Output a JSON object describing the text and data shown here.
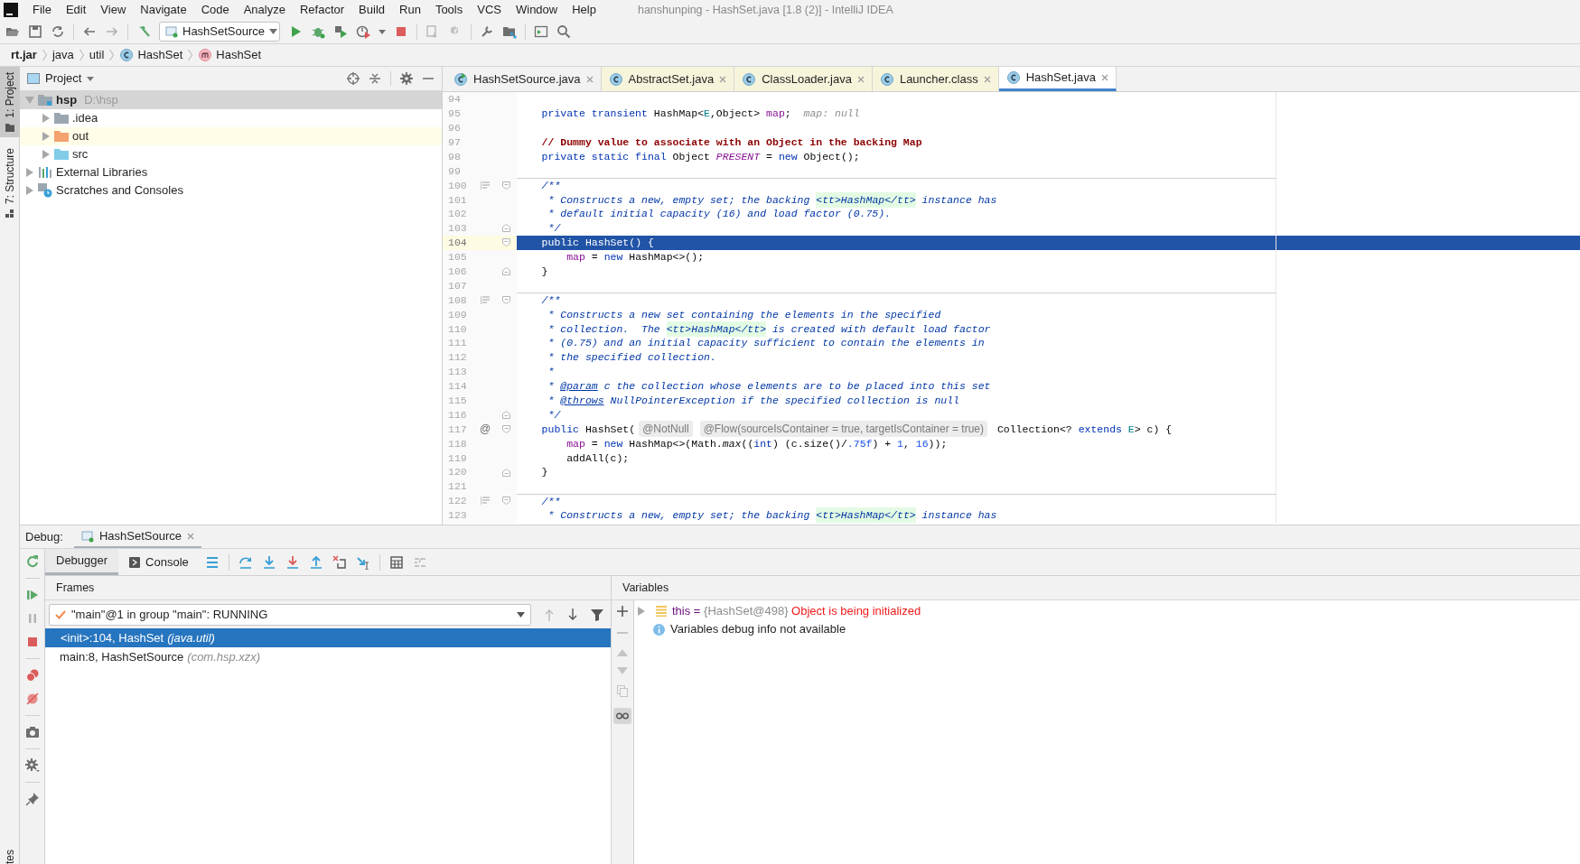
{
  "window": {
    "title": "hanshunping - HashSet.java [1.8 (2)] - IntelliJ IDEA"
  },
  "menu": [
    "File",
    "Edit",
    "View",
    "Navigate",
    "Code",
    "Analyze",
    "Refactor",
    "Build",
    "Run",
    "Tools",
    "VCS",
    "Window",
    "Help"
  ],
  "run_config": {
    "label": "HashSetSource"
  },
  "breadcrumbs": [
    {
      "text": "rt.jar",
      "kind": "jar"
    },
    {
      "text": "java",
      "kind": "package"
    },
    {
      "text": "util",
      "kind": "package"
    },
    {
      "text": "HashSet",
      "kind": "class"
    },
    {
      "text": "HashSet",
      "kind": "method"
    }
  ],
  "tool_strip": [
    {
      "label": "1: Project",
      "selected": true
    },
    {
      "label": "7: Structure",
      "selected": false
    }
  ],
  "tool_strip_bottom": {
    "label": "tes"
  },
  "project": {
    "title": "Project",
    "tree": [
      {
        "label": "hsp",
        "detail": "D:\\hsp",
        "kind": "project",
        "expanded": true,
        "selected": true,
        "highlighted": false,
        "children": [
          {
            "label": ".idea",
            "kind": "folder",
            "expanded": false,
            "selected": false,
            "highlighted": false
          },
          {
            "label": "out",
            "kind": "excluded",
            "expanded": false,
            "selected": false,
            "highlighted": true
          },
          {
            "label": "src",
            "kind": "source",
            "expanded": false,
            "selected": false,
            "highlighted": false
          }
        ]
      },
      {
        "label": "External Libraries",
        "kind": "libraries",
        "expanded": false,
        "selected": false,
        "highlighted": false
      },
      {
        "label": "Scratches and Consoles",
        "kind": "scratches",
        "expanded": false,
        "selected": false,
        "highlighted": false
      }
    ]
  },
  "editor": {
    "tabs": [
      {
        "label": "HashSetSource.java",
        "kind": "source",
        "selected": false
      },
      {
        "label": "AbstractSet.java",
        "kind": "library",
        "selected": false
      },
      {
        "label": "ClassLoader.java",
        "kind": "library",
        "selected": false
      },
      {
        "label": "Launcher.class",
        "kind": "library",
        "selected": false
      },
      {
        "label": "HashSet.java",
        "kind": "library",
        "selected": true
      }
    ],
    "lines": [
      {
        "number": "94",
        "current": false,
        "separator": false
      },
      {
        "number": "95",
        "current": false,
        "separator": false,
        "code": [
          {
            "kind": "keyword",
            "text": "    private transient "
          },
          {
            "kind": "plain",
            "text": "HashMap<"
          },
          {
            "kind": "typeparam",
            "text": "E"
          },
          {
            "kind": "plain",
            "text": ",Object> "
          },
          {
            "kind": "field",
            "text": "map"
          },
          {
            "kind": "plain",
            "text": ";"
          },
          {
            "kind": "hint",
            "text": "  map: null"
          }
        ]
      },
      {
        "number": "96",
        "current": false,
        "separator": false
      },
      {
        "number": "97",
        "current": false,
        "separator": false,
        "code": [
          {
            "kind": "comment",
            "text": "    // Dummy value to associate with an Object in the backing Map"
          }
        ]
      },
      {
        "number": "98",
        "current": false,
        "separator": false,
        "code": [
          {
            "kind": "keyword",
            "text": "    private static final "
          },
          {
            "kind": "plain",
            "text": "Object "
          },
          {
            "kind": "static",
            "text": "PRESENT"
          },
          {
            "kind": "plain",
            "text": " = "
          },
          {
            "kind": "keyword",
            "text": "new "
          },
          {
            "kind": "plain",
            "text": "Object();"
          }
        ]
      },
      {
        "number": "99",
        "current": false,
        "separator": false
      },
      {
        "number": "100",
        "current": false,
        "separator": true,
        "doc_toggle": true,
        "fold_start": true,
        "code": [
          {
            "kind": "doc",
            "text": "    /**"
          }
        ]
      },
      {
        "number": "101",
        "current": false,
        "separator": false,
        "code": [
          {
            "kind": "doc",
            "text": "     * Constructs a new, empty set; the backing "
          },
          {
            "kind": "doctag",
            "text": "<tt>HashMap</tt>"
          },
          {
            "kind": "doc",
            "text": " instance has"
          }
        ]
      },
      {
        "number": "102",
        "current": false,
        "separator": false,
        "code": [
          {
            "kind": "doc",
            "text": "     * default initial capacity (16) and load factor (0.75)."
          }
        ]
      },
      {
        "number": "103",
        "current": false,
        "separator": false,
        "fold_end": true,
        "code": [
          {
            "kind": "doc",
            "text": "     */"
          }
        ]
      },
      {
        "number": "104",
        "current": true,
        "separator": false,
        "fold_start": true,
        "code": [
          {
            "kind": "keyword",
            "text": "    public "
          },
          {
            "kind": "plain",
            "text": "HashSet() {"
          }
        ]
      },
      {
        "number": "105",
        "current": false,
        "separator": false,
        "code": [
          {
            "kind": "field",
            "text": "        map"
          },
          {
            "kind": "plain",
            "text": " = "
          },
          {
            "kind": "keyword",
            "text": "new "
          },
          {
            "kind": "plain",
            "text": "HashMap<>();"
          }
        ]
      },
      {
        "number": "106",
        "current": false,
        "separator": false,
        "fold_end": true,
        "code": [
          {
            "kind": "plain",
            "text": "    }"
          }
        ]
      },
      {
        "number": "107",
        "current": false,
        "separator": false
      },
      {
        "number": "108",
        "current": false,
        "separator": true,
        "doc_toggle": true,
        "fold_start": true,
        "code": [
          {
            "kind": "doc",
            "text": "    /**"
          }
        ]
      },
      {
        "number": "109",
        "current": false,
        "separator": false,
        "code": [
          {
            "kind": "doc",
            "text": "     * Constructs a new set containing the elements in the specified"
          }
        ]
      },
      {
        "number": "110",
        "current": false,
        "separator": false,
        "code": [
          {
            "kind": "doc",
            "text": "     * collection.  The "
          },
          {
            "kind": "doctag",
            "text": "<tt>HashMap</tt>"
          },
          {
            "kind": "doc",
            "text": " is created with default load factor"
          }
        ]
      },
      {
        "number": "111",
        "current": false,
        "separator": false,
        "code": [
          {
            "kind": "doc",
            "text": "     * (0.75) and an initial capacity sufficient to contain the elements in"
          }
        ]
      },
      {
        "number": "112",
        "current": false,
        "separator": false,
        "code": [
          {
            "kind": "doc",
            "text": "     * the specified collection."
          }
        ]
      },
      {
        "number": "113",
        "current": false,
        "separator": false,
        "code": [
          {
            "kind": "doc",
            "text": "     *"
          }
        ]
      },
      {
        "number": "114",
        "current": false,
        "separator": false,
        "code": [
          {
            "kind": "doc",
            "text": "     * "
          },
          {
            "kind": "doclink",
            "text": "@param"
          },
          {
            "kind": "doc",
            "text": " c the collection whose elements are to be placed into this set"
          }
        ]
      },
      {
        "number": "115",
        "current": false,
        "separator": false,
        "code": [
          {
            "kind": "doc",
            "text": "     * "
          },
          {
            "kind": "doclink",
            "text": "@throws"
          },
          {
            "kind": "doc",
            "text": " NullPointerException if the specified collection is null"
          }
        ]
      },
      {
        "number": "116",
        "current": false,
        "separator": false,
        "fold_end": true,
        "code": [
          {
            "kind": "doc",
            "text": "     */"
          }
        ]
      },
      {
        "number": "117",
        "current": false,
        "separator": false,
        "gutter_text": "@",
        "fold_start": true,
        "code": [
          {
            "kind": "keyword",
            "text": "    public "
          },
          {
            "kind": "plain",
            "text": "HashSet("
          },
          {
            "kind": "inlay",
            "text": "@NotNull"
          },
          {
            "kind": "inlay",
            "text": "@Flow(sourceIsContainer = true, targetIsContainer = true)"
          },
          {
            "kind": "plain",
            "text": " Collection<? "
          },
          {
            "kind": "keyword",
            "text": "extends "
          },
          {
            "kind": "typeparam",
            "text": "E"
          },
          {
            "kind": "plain",
            "text": "> c) {"
          }
        ]
      },
      {
        "number": "118",
        "current": false,
        "separator": false,
        "code": [
          {
            "kind": "field",
            "text": "        map"
          },
          {
            "kind": "plain",
            "text": " = "
          },
          {
            "kind": "keyword",
            "text": "new "
          },
          {
            "kind": "plain",
            "text": "HashMap<>(Math."
          },
          {
            "kind": "staticcall",
            "text": "max"
          },
          {
            "kind": "plain",
            "text": "(("
          },
          {
            "kind": "keyword",
            "text": "int"
          },
          {
            "kind": "plain",
            "text": ") (c.size()/"
          },
          {
            "kind": "number",
            "text": ".75f"
          },
          {
            "kind": "plain",
            "text": ") + "
          },
          {
            "kind": "number",
            "text": "1"
          },
          {
            "kind": "plain",
            "text": ", "
          },
          {
            "kind": "number",
            "text": "16"
          },
          {
            "kind": "plain",
            "text": "));"
          }
        ]
      },
      {
        "number": "119",
        "current": false,
        "separator": false,
        "code": [
          {
            "kind": "plain",
            "text": "        addAll(c);"
          }
        ]
      },
      {
        "number": "120",
        "current": false,
        "separator": false,
        "fold_end": true,
        "code": [
          {
            "kind": "plain",
            "text": "    }"
          }
        ]
      },
      {
        "number": "121",
        "current": false,
        "separator": false
      },
      {
        "number": "122",
        "current": false,
        "separator": true,
        "doc_toggle": true,
        "fold_start": true,
        "code": [
          {
            "kind": "doc",
            "text": "    /**"
          }
        ]
      },
      {
        "number": "123",
        "current": false,
        "separator": false,
        "code": [
          {
            "kind": "doc",
            "text": "     * Constructs a new, empty set; the backing "
          },
          {
            "kind": "doctag",
            "text": "<tt>HashMap</tt>"
          },
          {
            "kind": "doc",
            "text": " instance has"
          }
        ]
      }
    ]
  },
  "debug": {
    "label": "Debug:",
    "session_tab": {
      "label": "HashSetSource"
    },
    "tabs": [
      {
        "label": "Debugger",
        "selected": true
      },
      {
        "label": "Console",
        "selected": false
      }
    ],
    "frames": {
      "title": "Frames",
      "thread": "\"main\"@1 in group \"main\": RUNNING",
      "items": [
        {
          "method": "<init>:104, HashSet",
          "package": "(java.util)",
          "selected": true
        },
        {
          "method": "main:8, HashSetSource",
          "package": "(com.hsp.xzx)",
          "selected": false
        }
      ]
    },
    "variables": {
      "title": "Variables",
      "items": [
        {
          "kind": "object",
          "text": "this = ",
          "value": "{HashSet@498}",
          "message": "Object is being initialized",
          "expanded": false
        },
        {
          "kind": "info",
          "text": "Variables debug info not available"
        }
      ]
    }
  }
}
